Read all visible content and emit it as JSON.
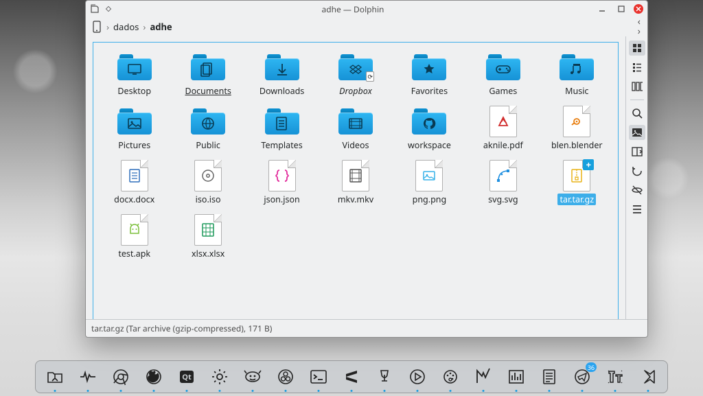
{
  "window": {
    "title": "adhe — Dolphin",
    "breadcrumb": {
      "root_icon": "device-phone",
      "parts": [
        "dados",
        "adhe"
      ],
      "current": "adhe"
    }
  },
  "side_tools": [
    {
      "name": "view-icons-large",
      "active": true
    },
    {
      "name": "view-list",
      "active": false
    },
    {
      "name": "view-columns",
      "active": false
    },
    {
      "sep": true
    },
    {
      "name": "search",
      "active": false
    },
    {
      "name": "preview",
      "active": true
    },
    {
      "name": "split-view",
      "active": false
    },
    {
      "name": "history",
      "active": false
    },
    {
      "name": "visibility",
      "active": false
    },
    {
      "name": "menu",
      "active": false
    }
  ],
  "items": [
    {
      "label": "Desktop",
      "kind": "folder",
      "glyph": "desktop"
    },
    {
      "label": "Documents",
      "kind": "folder",
      "glyph": "documents",
      "underline": true
    },
    {
      "label": "Downloads",
      "kind": "folder",
      "glyph": "download"
    },
    {
      "label": "Dropbox",
      "kind": "folder",
      "glyph": "dropbox",
      "italic": true,
      "emblem": "sync"
    },
    {
      "label": "Favorites",
      "kind": "folder",
      "glyph": "star"
    },
    {
      "label": "Games",
      "kind": "folder",
      "glyph": "gamepad"
    },
    {
      "label": "Music",
      "kind": "folder",
      "glyph": "music"
    },
    {
      "label": "Pictures",
      "kind": "folder",
      "glyph": "image"
    },
    {
      "label": "Public",
      "kind": "folder",
      "glyph": "public"
    },
    {
      "label": "Templates",
      "kind": "folder",
      "glyph": "templates"
    },
    {
      "label": "Videos",
      "kind": "folder",
      "glyph": "video"
    },
    {
      "label": "workspace",
      "kind": "folder",
      "glyph": "github"
    },
    {
      "label": "aknile.pdf",
      "kind": "file",
      "glyph": "pdf",
      "color": "#d12c2c"
    },
    {
      "label": "blen.blender",
      "kind": "file",
      "glyph": "blender",
      "color": "#e87d0d"
    },
    {
      "label": "docx.docx",
      "kind": "file",
      "glyph": "doc",
      "color": "#2e6fbb"
    },
    {
      "label": "iso.iso",
      "kind": "file",
      "glyph": "disc",
      "color": "#666"
    },
    {
      "label": "json.json",
      "kind": "file",
      "glyph": "json",
      "color": "#e22a9b"
    },
    {
      "label": "mkv.mkv",
      "kind": "file",
      "glyph": "film",
      "color": "#555"
    },
    {
      "label": "png.png",
      "kind": "file",
      "glyph": "img",
      "color": "#35b1e8"
    },
    {
      "label": "svg.svg",
      "kind": "file",
      "glyph": "vector",
      "color": "#1f8fe0"
    },
    {
      "label": "tar.tar.gz",
      "kind": "file",
      "glyph": "archive",
      "color": "#e8b419",
      "emblem": "plus",
      "selected": true
    },
    {
      "label": "test.apk",
      "kind": "file",
      "glyph": "android",
      "color": "#7bbf3a"
    },
    {
      "label": "xlsx.xlsx",
      "kind": "file",
      "glyph": "sheet",
      "color": "#1e9a5b"
    }
  ],
  "status": "tar.tar.gz (Tar archive (gzip-compressed), 171 B)",
  "dock": {
    "items": [
      {
        "name": "file-manager",
        "running": true
      },
      {
        "name": "system-monitor",
        "running": true
      },
      {
        "name": "chrome",
        "running": true
      },
      {
        "name": "firefox",
        "running": true
      },
      {
        "name": "qt-creator",
        "running": true
      },
      {
        "name": "settings",
        "running": true
      },
      {
        "name": "gimp",
        "running": true
      },
      {
        "name": "obs",
        "running": true
      },
      {
        "name": "terminal",
        "running": true
      },
      {
        "name": "sublime",
        "running": true
      },
      {
        "name": "wine",
        "running": true
      },
      {
        "name": "media-player",
        "running": true
      },
      {
        "name": "krita",
        "running": true
      },
      {
        "name": "kate",
        "running": true
      },
      {
        "name": "audio-mixer",
        "running": true
      },
      {
        "name": "notes",
        "running": true
      },
      {
        "name": "telegram",
        "running": true,
        "badge": "36"
      },
      {
        "name": "typography",
        "running": true
      },
      {
        "name": "vscode",
        "running": true
      }
    ]
  }
}
